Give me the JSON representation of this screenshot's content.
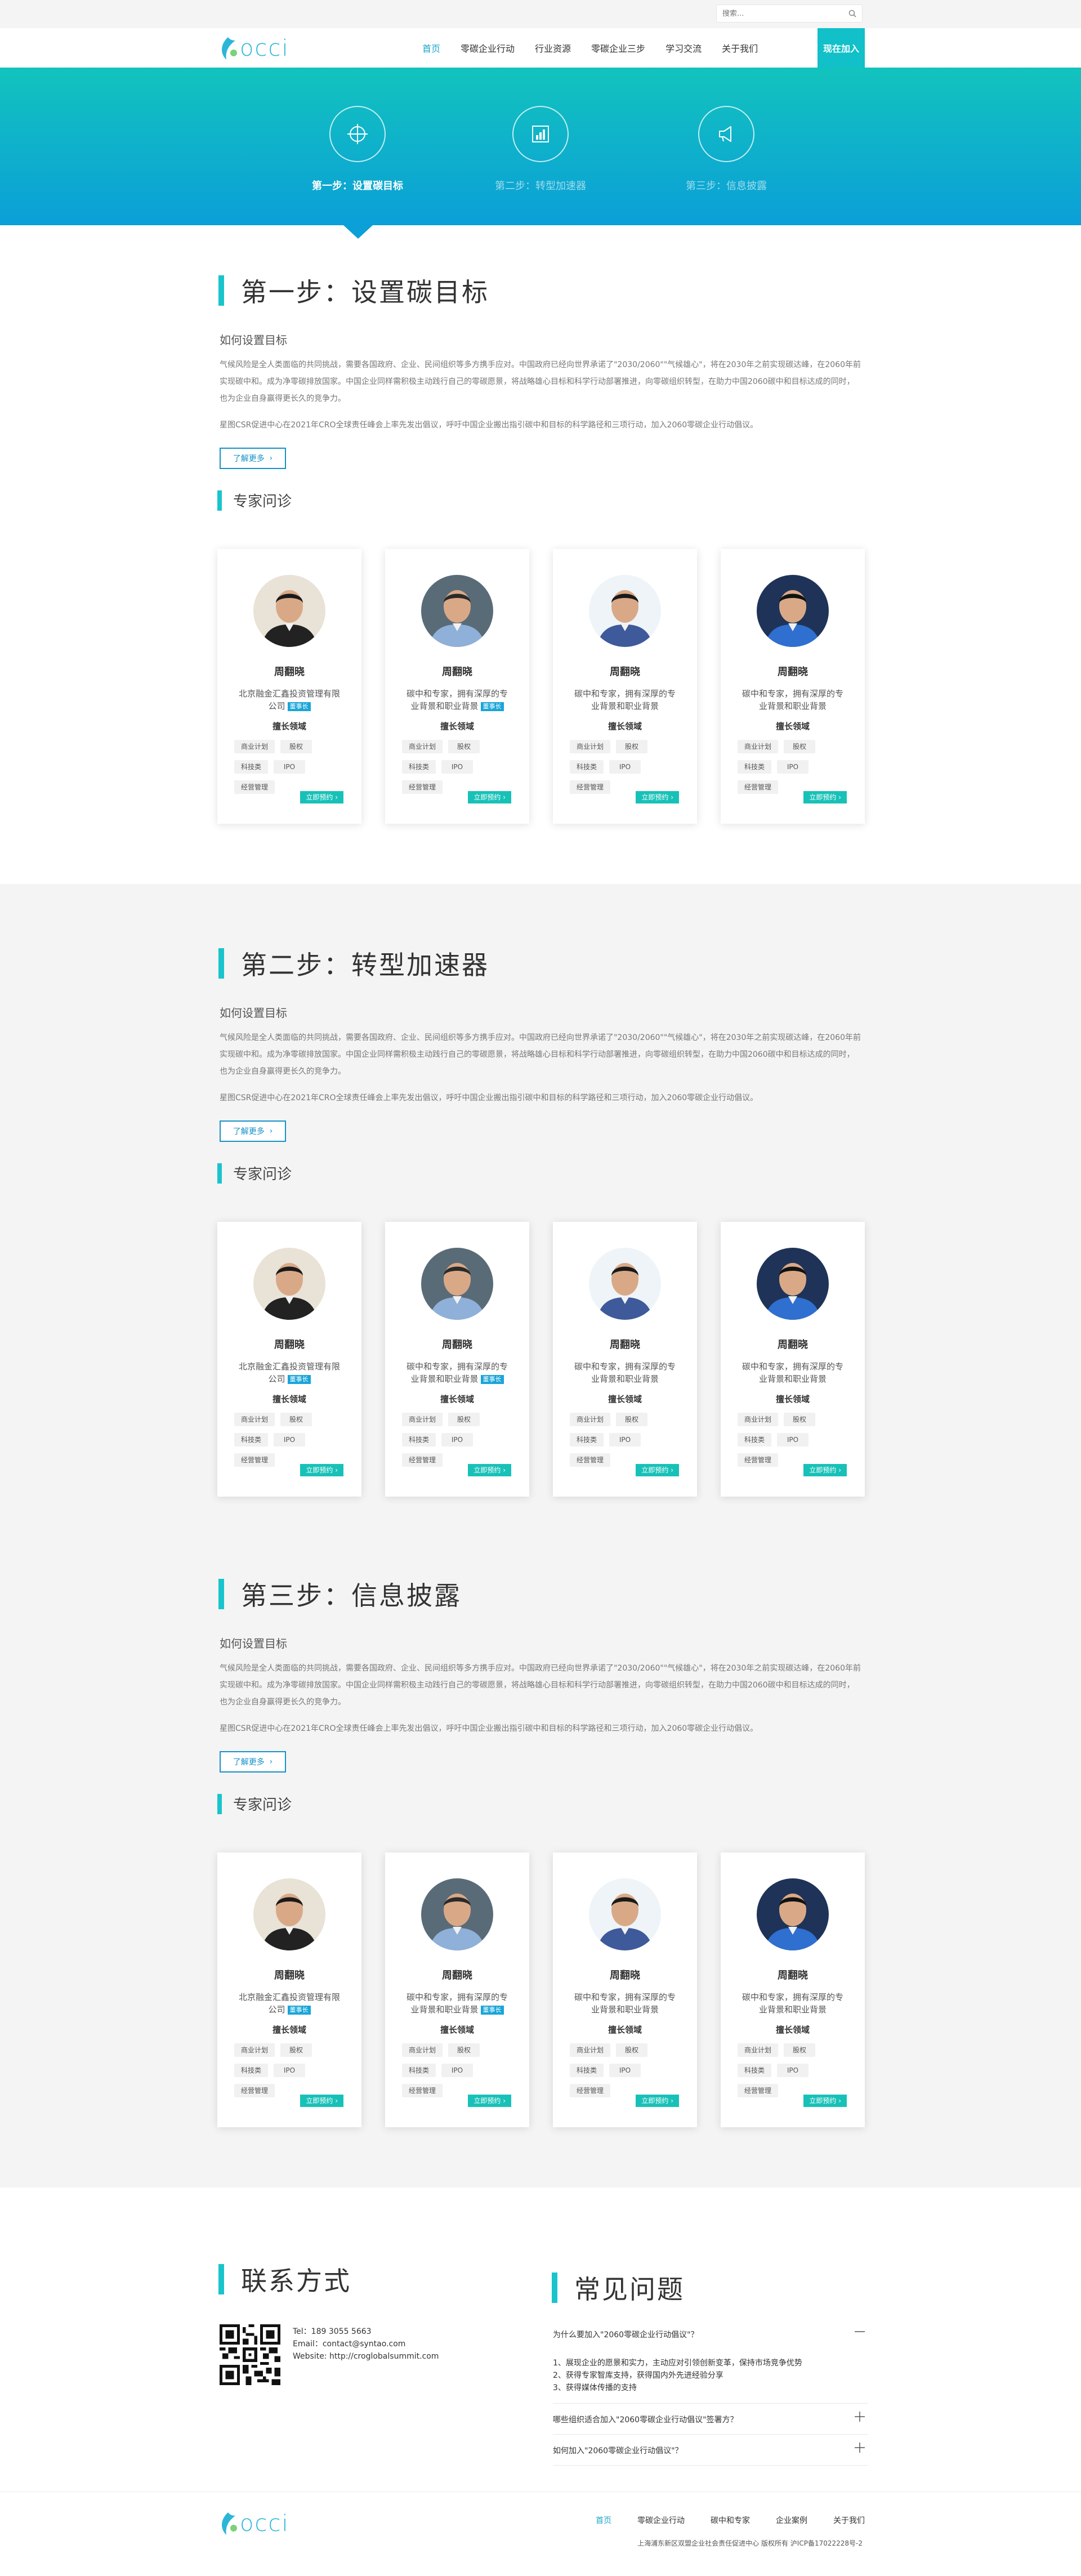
{
  "search": {
    "placeholder": "搜索..."
  },
  "brand": {
    "logo_text": "occi"
  },
  "nav": {
    "items": [
      {
        "label": "首页",
        "active": true
      },
      {
        "label": "零碳企业行动",
        "active": false
      },
      {
        "label": "行业资源",
        "active": false
      },
      {
        "label": "零碳企业三步",
        "active": false
      },
      {
        "label": "学习交流",
        "active": false
      },
      {
        "label": "关于我们",
        "active": false
      }
    ],
    "join_label": "现在加入"
  },
  "banner": {
    "steps": [
      {
        "label": "第一步：设置碳目标",
        "icon": "crosshair-icon",
        "active": true
      },
      {
        "label": "第二步：转型加速器",
        "icon": "bar-chart-icon",
        "active": false
      },
      {
        "label": "第三步：信息披露",
        "icon": "megaphone-icon",
        "active": false
      }
    ]
  },
  "sections": [
    {
      "title": "第一步：设置碳目标",
      "question": "如何设置目标",
      "paragraph1": "气候风险是全人类面临的共同挑战，需要各国政府、企业、民间组织等多方携手应对。中国政府已经向世界承诺了\"2030/2060\"\"气候雄心\"，将在2030年之前实现碳达峰，在2060年前实现碳中和。成为净零碳排放国家。中国企业同样需积极主动践行自己的零碳愿景，将战略雄心目标和科学行动部署推进，向零碳组织转型，在助力中国2060碳中和目标达成的同时，也为企业自身赢得更长久的竞争力。",
      "paragraph2": "星图CSR促进中心在2021年CRO全球责任峰会上率先发出倡议，呼吁中国企业搬出指引碳中和目标的科学路径和三项行动，加入2060零碳企业行动倡议。",
      "more_label": "了解更多",
      "experts_title": "专家问诊"
    },
    {
      "title": "第二步：转型加速器",
      "question": "如何设置目标",
      "paragraph1": "气候风险是全人类面临的共同挑战，需要各国政府、企业、民间组织等多方携手应对。中国政府已经向世界承诺了\"2030/2060\"\"气候雄心\"，将在2030年之前实现碳达峰，在2060年前实现碳中和。成为净零碳排放国家。中国企业同样需积极主动践行自己的零碳愿景，将战略雄心目标和科学行动部署推进，向零碳组织转型，在助力中国2060碳中和目标达成的同时，也为企业自身赢得更长久的竞争力。",
      "paragraph2": "星图CSR促进中心在2021年CRO全球责任峰会上率先发出倡议，呼吁中国企业搬出指引碳中和目标的科学路径和三项行动，加入2060零碳企业行动倡议。",
      "more_label": "了解更多",
      "experts_title": "专家问诊"
    },
    {
      "title": "第三步：信息披露",
      "question": "如何设置目标",
      "paragraph1": "气候风险是全人类面临的共同挑战，需要各国政府、企业、民间组织等多方携手应对。中国政府已经向世界承诺了\"2030/2060\"\"气候雄心\"，将在2030年之前实现碳达峰，在2060年前实现碳中和。成为净零碳排放国家。中国企业同样需积极主动践行自己的零碳愿景，将战略雄心目标和科学行动部署推进，向零碳组织转型，在助力中国2060碳中和目标达成的同时，也为企业自身赢得更长久的竞争力。",
      "paragraph2": "星图CSR促进中心在2021年CRO全球责任峰会上率先发出倡议，呼吁中国企业搬出指引碳中和目标的科学路径和三项行动，加入2060零碳企业行动倡议。",
      "more_label": "了解更多",
      "experts_title": "专家问诊"
    }
  ],
  "experts": [
    {
      "name": "周翻晓",
      "desc": "北京融金汇鑫投资管理有限公司",
      "badge": "董事长",
      "field_label": "擅长领域",
      "tags": [
        "商业计划",
        "股权",
        "科技类",
        "IPO",
        "经营管理"
      ],
      "book_label": "立即预约"
    },
    {
      "name": "周翻晓",
      "desc": "碳中和专家，拥有深厚的专业背景和职业背景",
      "badge": "董事长",
      "field_label": "擅长领域",
      "tags": [
        "商业计划",
        "股权",
        "科技类",
        "IPO",
        "经营管理"
      ],
      "book_label": "立即预约"
    },
    {
      "name": "周翻晓",
      "desc": "碳中和专家，拥有深厚的专业背景和职业背景",
      "badge": "",
      "field_label": "擅长领域",
      "tags": [
        "商业计划",
        "股权",
        "科技类",
        "IPO",
        "经营管理"
      ],
      "book_label": "立即预约"
    },
    {
      "name": "周翻晓",
      "desc": "碳中和专家，拥有深厚的专业背景和职业背景",
      "badge": "",
      "field_label": "擅长领域",
      "tags": [
        "商业计划",
        "股权",
        "科技类",
        "IPO",
        "经营管理"
      ],
      "book_label": "立即预约"
    }
  ],
  "contact": {
    "title": "联系方式",
    "tel": "Tel：189 3055 5663",
    "email": "Email：contact@syntao.com",
    "website": "Website: http://croglobalsummit.com"
  },
  "faq": {
    "title": "常见问题",
    "items": [
      {
        "question": "为什么要加入\"2060零碳企业行动倡议\"？",
        "open": true,
        "answers": [
          "1、展现企业的愿景和实力，主动应对引领创新变革，保持市场竞争优势",
          "2、获得专家智库支持，获得国内外先进经验分享",
          "3、获得媒体传播的支持"
        ]
      },
      {
        "question": "哪些组织适合加入\"2060零碳企业行动倡议\"签署方？",
        "open": false,
        "answers": []
      },
      {
        "question": "如何加入\"2060零碳企业行动倡议\"？",
        "open": false,
        "answers": []
      }
    ]
  },
  "footer": {
    "links": [
      {
        "label": "首页",
        "active": true
      },
      {
        "label": "零碳企业行动",
        "active": false
      },
      {
        "label": "碳中和专家",
        "active": false
      },
      {
        "label": "企业案例",
        "active": false
      },
      {
        "label": "关于我们",
        "active": false
      }
    ],
    "copyright": "上海浦东新区双盟企业社会责任促进中心 版权所有 沪ICP备17022228号-2"
  },
  "colors": {
    "accent": "#19c4cc",
    "nav_active": "#1aa5c9",
    "banner_top": "#12c3bd",
    "banner_bottom": "#0b9fd8",
    "button_border": "#1591c8"
  }
}
